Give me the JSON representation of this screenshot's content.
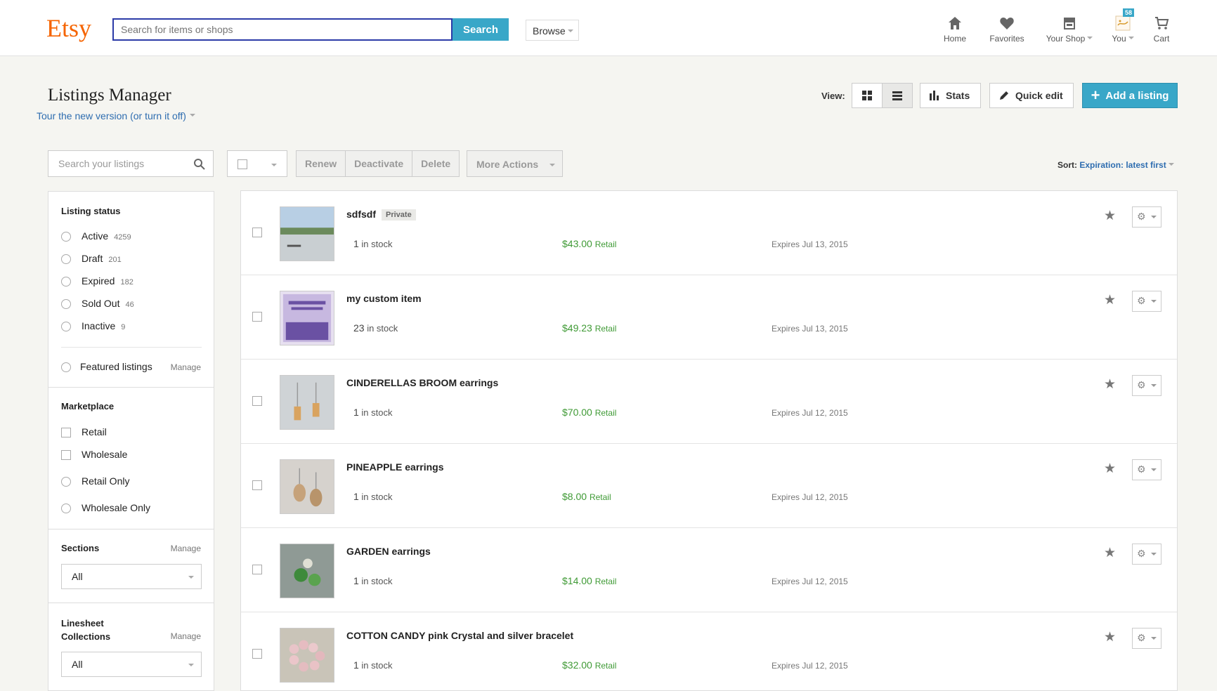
{
  "header": {
    "logo": "Etsy",
    "search_placeholder": "Search for items or shops",
    "search_button": "Search",
    "browse": "Browse",
    "nav": [
      {
        "label": "Home",
        "icon": "home-icon"
      },
      {
        "label": "Favorites",
        "icon": "heart-icon"
      },
      {
        "label": "Your Shop",
        "icon": "shop-icon",
        "dropdown": true
      },
      {
        "label": "You",
        "icon": "avatar-icon",
        "dropdown": true,
        "badge": "58"
      },
      {
        "label": "Cart",
        "icon": "cart-icon"
      }
    ]
  },
  "page": {
    "title": "Listings Manager",
    "version_link": "Tour the new version (or turn it off)"
  },
  "toolbar": {
    "view_label": "View:",
    "stats": "Stats",
    "quick_edit": "Quick edit",
    "add_listing": "Add a listing"
  },
  "controls": {
    "search_placeholder": "Search your listings",
    "renew": "Renew",
    "deactivate": "Deactivate",
    "delete": "Delete",
    "more_actions": "More Actions",
    "sort_label": "Sort:",
    "sort_value": "Expiration: latest first"
  },
  "sidebar": {
    "listing_status_heading": "Listing status",
    "statuses": [
      {
        "label": "Active",
        "count": "4259"
      },
      {
        "label": "Draft",
        "count": "201"
      },
      {
        "label": "Expired",
        "count": "182"
      },
      {
        "label": "Sold Out",
        "count": "46"
      },
      {
        "label": "Inactive",
        "count": "9"
      }
    ],
    "featured": "Featured listings",
    "featured_manage": "Manage",
    "marketplace_heading": "Marketplace",
    "marketplace": [
      "Retail",
      "Wholesale",
      "Retail Only",
      "Wholesale Only"
    ],
    "sections_heading": "Sections",
    "sections_manage": "Manage",
    "sections_value": "All",
    "linesheet_heading_1": "Linesheet",
    "linesheet_heading_2": "Collections",
    "linesheet_manage": "Manage",
    "linesheet_value": "All"
  },
  "listings": [
    {
      "title": "sdfsdf",
      "badge": "Private",
      "qty": "1",
      "stock_suffix": " in stock",
      "price": "$43.00",
      "price_type": "Retail",
      "expires": "Expires Jul 13, 2015"
    },
    {
      "title": "my custom item",
      "badge": "",
      "qty": "23",
      "stock_suffix": " in stock",
      "price": "$49.23",
      "price_type": "Retail",
      "expires": "Expires Jul 13, 2015"
    },
    {
      "title": "CINDERELLAS BROOM earrings",
      "badge": "",
      "qty": "1",
      "stock_suffix": " in stock",
      "price": "$70.00",
      "price_type": "Retail",
      "expires": "Expires Jul 12, 2015"
    },
    {
      "title": "PINEAPPLE earrings",
      "badge": "",
      "qty": "1",
      "stock_suffix": " in stock",
      "price": "$8.00",
      "price_type": "Retail",
      "expires": "Expires Jul 12, 2015"
    },
    {
      "title": "GARDEN earrings",
      "badge": "",
      "qty": "1",
      "stock_suffix": " in stock",
      "price": "$14.00",
      "price_type": "Retail",
      "expires": "Expires Jul 12, 2015"
    },
    {
      "title": "COTTON CANDY pink Crystal and silver bracelet",
      "badge": "",
      "qty": "1",
      "stock_suffix": " in stock",
      "price": "$32.00",
      "price_type": "Retail",
      "expires": "Expires Jul 12, 2015"
    }
  ],
  "colors": {
    "brand": "#f56400",
    "accent": "#39a7c8",
    "price": "#3f9a35",
    "link": "#2e6db0"
  }
}
